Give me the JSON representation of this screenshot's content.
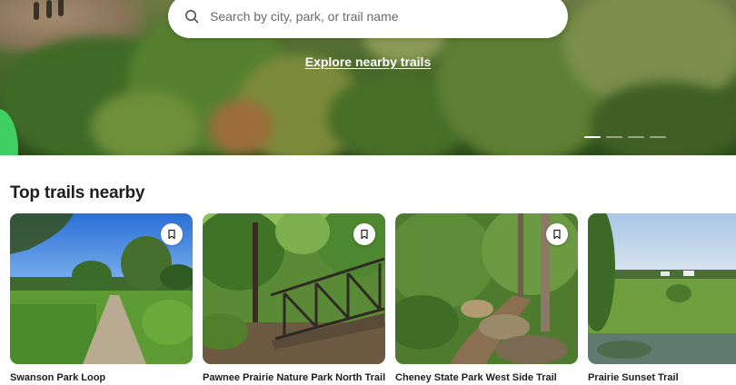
{
  "search": {
    "placeholder": "Search by city, park, or trail name",
    "icon": "search-icon"
  },
  "hero": {
    "explore_link": "Explore nearby trails",
    "carousel_total": 4,
    "carousel_active": 1
  },
  "section": {
    "title": "Top trails nearby"
  },
  "cards": [
    {
      "name": "Swanson Park Loop",
      "icon": "bookmark-icon"
    },
    {
      "name": "Pawnee Prairie Nature Park North Trail",
      "icon": "bookmark-icon"
    },
    {
      "name": "Cheney State Park West Side Trail",
      "icon": "bookmark-icon"
    },
    {
      "name": "Prairie Sunset Trail",
      "icon": "bookmark-icon"
    }
  ]
}
